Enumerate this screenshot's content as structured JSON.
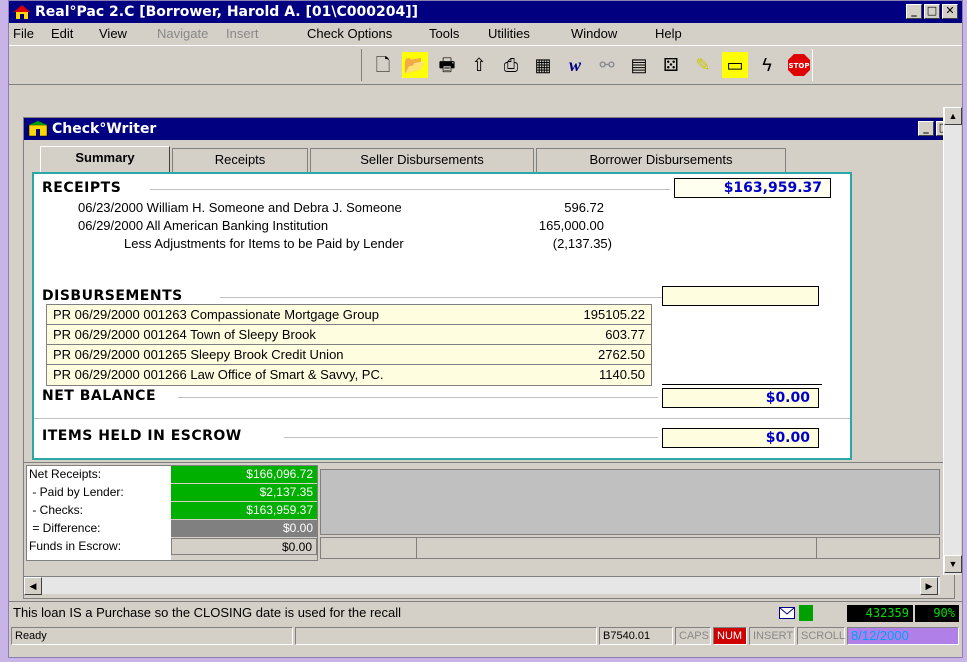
{
  "window": {
    "title": "Real°Pac 2.C [Borrower, Harold A. [01\\C000204]]"
  },
  "menu": [
    "File",
    "Edit",
    "View",
    "Navigate",
    "Insert",
    "Check Options",
    "Tools",
    "Utilities",
    "Window",
    "Help"
  ],
  "menu_disabled": [
    "Navigate",
    "Insert"
  ],
  "toolbar_icons": [
    "new-doc-icon",
    "open-folder-icon",
    "print-icon",
    "up-arrow-icon",
    "scanner-icon",
    "calendar-icon",
    "w-icon",
    "network-icon",
    "calculator-icon",
    "dice-icon",
    "notes-icon",
    "card-icon",
    "lightning-icon",
    "stop-icon"
  ],
  "toolbar_stop_label": "STOP",
  "child": {
    "title": "Check°Writer"
  },
  "tabs": [
    "Summary",
    "Receipts",
    "Seller Disbursements",
    "Borrower Disbursements"
  ],
  "receipts": {
    "heading": "RECEIPTS",
    "total": "$163,959.37",
    "lines": [
      {
        "text": "06/23/2000  William H. Someone and Debra J. Someone",
        "amount": "596.72"
      },
      {
        "text": "06/29/2000  All American Banking Institution",
        "amount": "165,000.00"
      },
      {
        "text": "Less Adjustments for Items to be Paid by Lender",
        "amount": "(2,137.35)"
      }
    ]
  },
  "disbursements": {
    "heading": "DISBURSEMENTS",
    "total": "",
    "rows": [
      {
        "text": "PR 06/29/2000  001263  Compassionate Mortgage Group",
        "amount": "195105.22"
      },
      {
        "text": "PR 06/29/2000  001264  Town of Sleepy Brook",
        "amount": "603.77"
      },
      {
        "text": "PR 06/29/2000  001265  Sleepy Brook Credit Union",
        "amount": "2762.50"
      },
      {
        "text": "PR 06/29/2000  001266  Law Office of Smart & Savvy, PC.",
        "amount": "1140.50"
      }
    ]
  },
  "net_balance": {
    "label": "NET BALANCE",
    "value": "$0.00"
  },
  "escrow": {
    "label": "ITEMS HELD IN ESCROW",
    "value": "$0.00"
  },
  "summary": [
    {
      "label": "Net Receipts:",
      "value": "$166,096.72",
      "style": "green"
    },
    {
      "label": " - Paid by Lender:",
      "value": "$2,137.35",
      "style": "green"
    },
    {
      "label": " - Checks:",
      "value": "$163,959.37",
      "style": "green"
    },
    {
      "label": " = Difference:",
      "value": "$0.00",
      "style": "grey"
    },
    {
      "label": "Funds in Escrow:",
      "value": "$0.00",
      "style": "light"
    }
  ],
  "message": "This loan IS a Purchase so the CLOSING date is used for the recall",
  "counter": "432359",
  "percent": "90%",
  "status": {
    "ready": "Ready",
    "code": "B7540.01",
    "caps": "CAPS",
    "num": "NUM",
    "insert": "INSERT",
    "scroll": "SCROLL",
    "date": "8/12/2000"
  },
  "colors": {
    "title_bar": "#000080",
    "panel_border": "#2aa8a8",
    "amount_text": "#0000c8",
    "green_cell": "#00b000",
    "num_active": "#d00000"
  }
}
